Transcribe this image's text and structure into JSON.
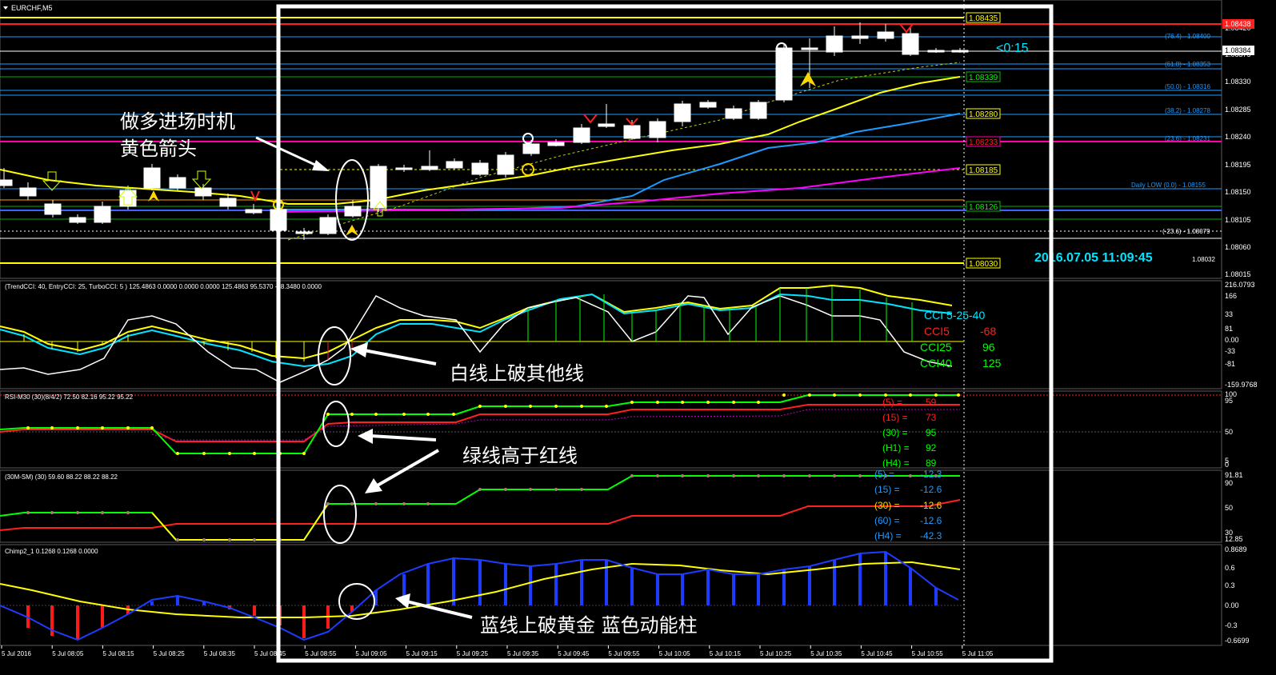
{
  "chart_title": "EURCHF,M5",
  "price_panel": {
    "scale": [
      "1.08420",
      "1.08375",
      "1.08330",
      "1.08285",
      "1.08240",
      "1.08195",
      "1.08150",
      "1.08105",
      "1.08060",
      "1.08015"
    ],
    "current_price": "1.08384",
    "red_level": "1.08438",
    "magenta_level": "1.08233",
    "countdown": "<0:15",
    "timestamp": "2016.07.05 11:09:45",
    "level_boxes": [
      "1.08435",
      "1.08339",
      "1.08280",
      "1.08185",
      "1.08126",
      "1.08030"
    ],
    "fib_labels": [
      "(76.4) - 1.08400",
      "(61.8) - 1.08353",
      "(50.0) - 1.08316",
      "(38.2) - 1.08278",
      "(23.6) - 1.08231",
      "Daily LOW (0.0) - 1.08155",
      "(-23.6) - 1.08079",
      "1.08032"
    ],
    "annotation": [
      "做多进场时机",
      "黄色箭头"
    ]
  },
  "cci_panel": {
    "header": "(TrendCCI: 40, EntryCCI: 25, TurboCCI: 5 )  125.4863 0.0000 0.0000 0.0000 125.4863 95.5370 -68.3480 0.0000",
    "scale": [
      "216.0793",
      "166",
      "81",
      "33",
      "0.00",
      "-33",
      "-81",
      "-159.9768"
    ],
    "legend": [
      {
        "label": "CCI 5-25-40",
        "value": "",
        "color": "#00e5ff"
      },
      {
        "label": "CCI5",
        "value": "-68",
        "color": "#ff2020"
      },
      {
        "label": "CCI25",
        "value": "96",
        "color": "#00ff00"
      },
      {
        "label": "CCI40",
        "value": "125",
        "color": "#00ff00"
      }
    ],
    "annotation": "白线上破其他线"
  },
  "rsi_panel": {
    "header": "RSI-M30  (30)(8/4/2)   72.50 82.16 95.22 95.22",
    "scale": [
      "100",
      "95",
      "50",
      "5",
      "0"
    ],
    "legend": [
      {
        "label": "(5)  =",
        "value": "59",
        "color": "#ff2020"
      },
      {
        "label": "(15) =",
        "value": "73",
        "color": "#ff2020"
      },
      {
        "label": "(30) =",
        "value": "95",
        "color": "#00ff00"
      },
      {
        "label": "(H1) =",
        "value": "92",
        "color": "#00ff00"
      },
      {
        "label": "(H4) =",
        "value": "89",
        "color": "#00ff00"
      }
    ],
    "annotation": "绿线高于红线"
  },
  "sm_panel": {
    "header": "(30M-SM)  (30)  59.60 88.22 88.22 88.22",
    "scale": [
      "91.81",
      "90",
      "50",
      "30",
      "12.85"
    ],
    "legend": [
      {
        "label": "(5)  =",
        "value": "-12.3",
        "color": "#1e9bff"
      },
      {
        "label": "(15) =",
        "value": "-12.6",
        "color": "#1e9bff"
      },
      {
        "label": "(30) =",
        "value": "-12.6",
        "color": "#ffd700"
      },
      {
        "label": "(60) =",
        "value": "-12.6",
        "color": "#1e9bff"
      },
      {
        "label": "(H4) =",
        "value": "-42.3",
        "color": "#1e9bff"
      }
    ]
  },
  "chimp_panel": {
    "header": "Chimp2_1  0.1268 0.1268 0.0000",
    "scale": [
      "0.8689",
      "0.6",
      "0.3",
      "0.00",
      "-0.3",
      "-0.6699"
    ],
    "annotation": "蓝线上破黄金  蓝色动能柱"
  },
  "time_axis": [
    "5 Jul 2016",
    "5 Jul 08:05",
    "5 Jul 08:15",
    "5 Jul 08:25",
    "5 Jul 08:35",
    "5 Jul 08:45",
    "5 Jul 08:55",
    "5 Jul 09:05",
    "5 Jul 09:15",
    "5 Jul 09:25",
    "5 Jul 09:35",
    "5 Jul 09:45",
    "5 Jul 09:55",
    "5 Jul 10:05",
    "5 Jul 10:15",
    "5 Jul 10:25",
    "5 Jul 10:35",
    "5 Jul 10:45",
    "5 Jul 10:55",
    "5 Jul 11:05"
  ]
}
